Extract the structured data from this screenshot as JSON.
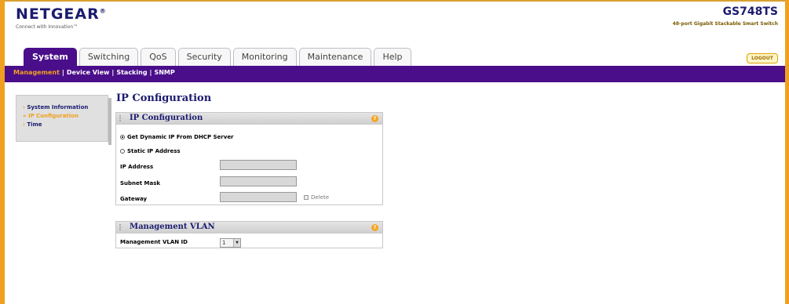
{
  "brand": {
    "logo": "NETGEAR",
    "logo_mark": "®",
    "tagline": "Connect with Innovation™"
  },
  "device": {
    "model": "GS748TS",
    "description": "48-port Gigabit Stackable Smart Switch"
  },
  "tabs": [
    {
      "label": "System",
      "active": true
    },
    {
      "label": "Switching"
    },
    {
      "label": "QoS"
    },
    {
      "label": "Security"
    },
    {
      "label": "Monitoring"
    },
    {
      "label": "Maintenance"
    },
    {
      "label": "Help"
    }
  ],
  "logout_label": "LOGOUT",
  "subnav": {
    "items": [
      "Management",
      "Device View",
      "Stacking",
      "SNMP"
    ],
    "separator": "|"
  },
  "sidenav": {
    "items": [
      {
        "label": "System Information",
        "marker": "›"
      },
      {
        "label": "IP Configuration",
        "marker": "»",
        "active": true
      },
      {
        "label": "Time",
        "marker": "›"
      }
    ]
  },
  "page_title": "IP Configuration",
  "ip_panel": {
    "title": "IP Configuration",
    "dhcp_label": "Get Dynamic IP From DHCP Server",
    "static_label": "Static IP Address",
    "ip_label": "IP Address",
    "ip_value": "",
    "mask_label": "Subnet Mask",
    "mask_value": "",
    "gateway_label": "Gateway",
    "gateway_value": "",
    "delete_label": "Delete",
    "selected_mode": "dhcp"
  },
  "vlan_panel": {
    "title": "Management VLAN",
    "vlan_label": "Management VLAN ID",
    "vlan_value": "1"
  },
  "help_icon": "?",
  "colors": {
    "accent_purple": "#4a0e8a",
    "accent_orange": "#f0a020",
    "brand_navy": "#1b1b6f"
  }
}
